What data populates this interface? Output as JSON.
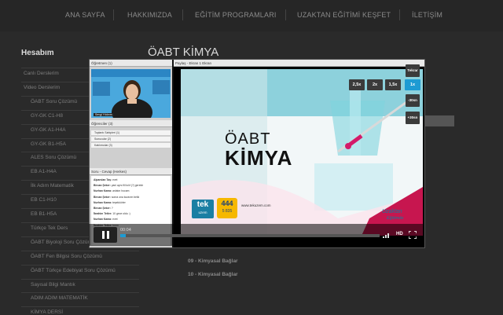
{
  "nav": {
    "items": [
      "ANA SAYFA",
      "HAKKIMIZDA",
      "EĞİTİM PROGRAMLARI",
      "UZAKTAN EĞİTİMİ KEŞFET",
      "İLETİŞİM"
    ]
  },
  "sidebar": {
    "title": "Hesabım",
    "items": [
      {
        "label": "Canlı Derslerim",
        "sub": false
      },
      {
        "label": "Video Derslerim",
        "sub": false
      },
      {
        "label": "ÖABT Soru Çözümü",
        "sub": true
      },
      {
        "label": "GY-GK C1-H8",
        "sub": true
      },
      {
        "label": "GY-GK A1-H4A",
        "sub": true
      },
      {
        "label": "GY-GK B1-H5A",
        "sub": true
      },
      {
        "label": "ALES Soru Çözümü",
        "sub": true
      },
      {
        "label": "EB A1-H4A",
        "sub": true
      },
      {
        "label": "İlk Adım Matematik",
        "sub": true
      },
      {
        "label": "EB C1-H10",
        "sub": true
      },
      {
        "label": "EB B1-H5A",
        "sub": true
      },
      {
        "label": "Türkçe Tek Ders",
        "sub": true
      },
      {
        "label": "ÖABT Biyoloji Soru Çözümü",
        "sub": true
      },
      {
        "label": "ÖABT Fen Bilgisi Soru Çözümü",
        "sub": true
      },
      {
        "label": "ÖABT Türkçe Edebiyat Soru Çözümü",
        "sub": true
      },
      {
        "label": "Sayısal Bilgi Mantık",
        "sub": true
      },
      {
        "label": "ADIM ADIM MATEMATİK",
        "sub": true
      },
      {
        "label": "KİMYA DERSİ",
        "sub": true
      }
    ]
  },
  "page": {
    "title": "ÖABT KİMYA"
  },
  "bottom_list": [
    "09 - Kimyasal Bağlar",
    "10 - Kimyasal Bağlar"
  ],
  "player": {
    "teacher_panel": "Öğretmen (1)",
    "teacher_name": "Sevgi Yıldırım",
    "students_panel": "Öğrenciler (3)",
    "groups": [
      "Toplantı Sahipleri (1)",
      "Sunucular (2)",
      "Katılımcılar (3)"
    ],
    "chat_panel": "Soru - Cevap (Herkes)",
    "chat": [
      {
        "name": "Alparslan Taş:",
        "text": "evet"
      },
      {
        "name": "Bircan Şeker:",
        "text": "yani aynı fiil kılıf (?) gerekir"
      },
      {
        "name": "Nurhan Kama:",
        "text": "anlatın hocam"
      },
      {
        "name": "Bircan Şeker:",
        "text": "sonra ona kurarım belki"
      },
      {
        "name": "Nurhan Kama:",
        "text": "teşekkürler"
      },
      {
        "name": "Bircan Şeker:",
        "text": "?"
      },
      {
        "name": "İbrahim Tetler:",
        "text": "10 gece oldu :)"
      },
      {
        "name": "Nurhan Kama:",
        "text": "evet"
      },
      {
        "name": "İbrahim Tetler:",
        "text": "hmm"
      }
    ],
    "screen_header": "Paylaş - Ekran 1 Ekran",
    "slide": {
      "line1": "ÖABT",
      "line2": "KİMYA",
      "tek": "tek",
      "tek_sub": "uzem",
      "phone_top": "444",
      "phone_bottom": "5 835",
      "web": "www.tekuzem.com",
      "script_line1": "Uzaktan",
      "script_line2": "Eğitimde"
    },
    "speeds": [
      "2,5x",
      "2x",
      "1,5x",
      "1x"
    ],
    "speed_active": "1x",
    "side_buttons": {
      "top": "Tekrar",
      "back": "-30sn",
      "fwd": "+30sn"
    },
    "time": "00:04",
    "progress": 0.02,
    "hd": "HD"
  }
}
